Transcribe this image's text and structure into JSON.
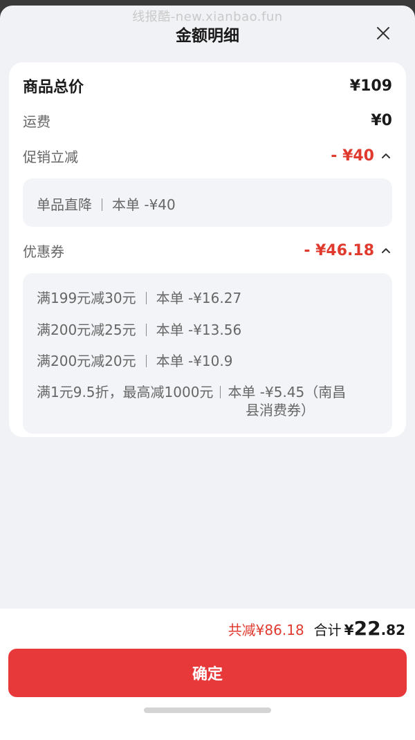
{
  "watermark": "线报酷-new.xianbao.fun",
  "header": {
    "title": "金额明细"
  },
  "card": {
    "goods_total": {
      "label": "商品总价",
      "value": "¥109"
    },
    "shipping": {
      "label": "运费",
      "value": "¥0"
    },
    "promotion": {
      "label": "促销立减",
      "value": "- ¥40",
      "items": [
        {
          "name": "单品直降",
          "amount": "本单 -¥40"
        }
      ]
    },
    "coupons": {
      "label": "优惠券",
      "value": "- ¥46.18",
      "items": [
        {
          "name": "满199元减30元",
          "amount": "本单 -¥16.27"
        },
        {
          "name": "满200元减25元",
          "amount": "本单 -¥13.56"
        },
        {
          "name": "满200元减20元",
          "amount": "本单 -¥10.9"
        },
        {
          "name": "满1元9.5折，最高减1000元",
          "amount": "本单 -¥5.45（南昌",
          "amount_cont": "县消费券）"
        }
      ]
    }
  },
  "footer": {
    "total_discount": "共减¥86.18",
    "total_label": "合计",
    "total_currency": "¥",
    "total_int": "22",
    "total_dec": ".82",
    "confirm_label": "确定"
  },
  "colors": {
    "accent_red": "#e8393a",
    "discount_red": "#e03a2f",
    "background": "#f1f2f5"
  }
}
